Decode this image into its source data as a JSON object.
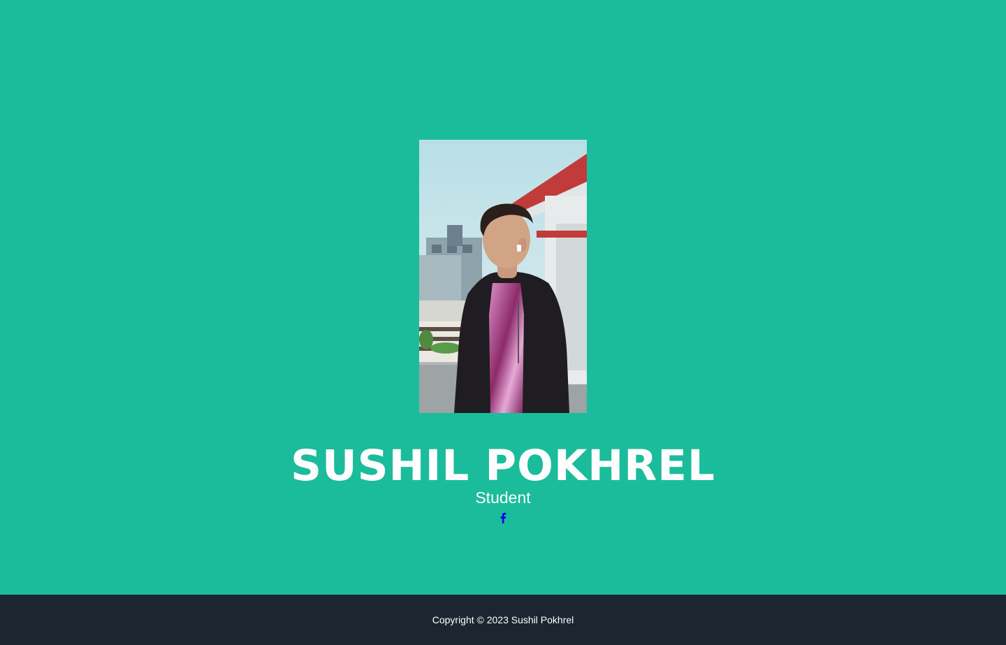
{
  "colors": {
    "hero_background": "#1bbc9b",
    "footer_background": "#1d2630",
    "text": "#ffffff",
    "social_icon": "#0000ee"
  },
  "profile": {
    "name": "SUSHIL POKHREL",
    "role": "Student",
    "photo_alt": "Sushil Pokhrel"
  },
  "social": {
    "icon": "facebook-icon"
  },
  "footer": {
    "copyright": "Copyright © 2023 Sushil Pokhrel"
  }
}
